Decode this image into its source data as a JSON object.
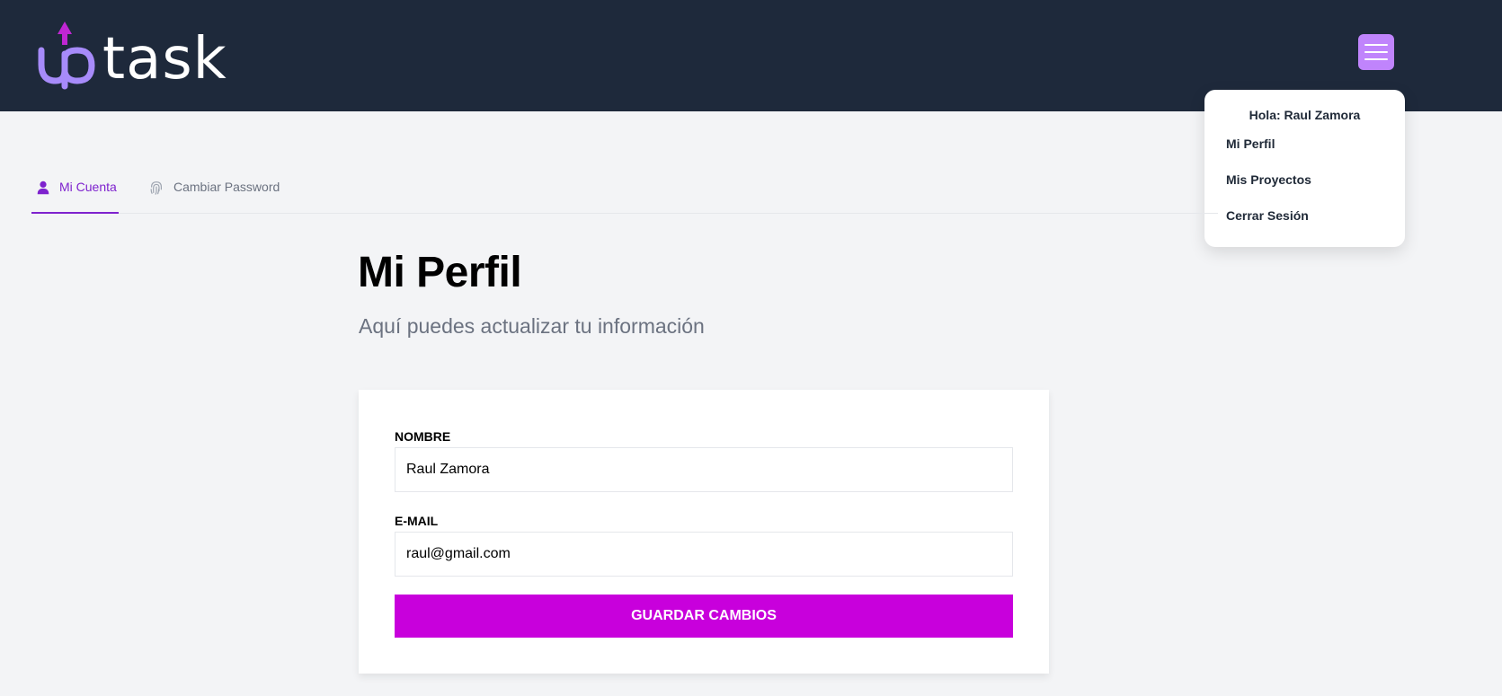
{
  "header": {
    "logo": {
      "prefix": "up",
      "suffix": "task",
      "icon": "arrow-up-logo-mark"
    },
    "menu_icon": "hamburger-menu-icon"
  },
  "dropdown": {
    "greeting": "Hola: Raul Zamora",
    "items": [
      "Mi Perfil",
      "Mis Proyectos",
      "Cerrar Sesión"
    ]
  },
  "tabs": [
    {
      "label": "Mi Cuenta",
      "icon": "user-icon",
      "active": true
    },
    {
      "label": "Cambiar Password",
      "icon": "fingerprint-icon",
      "active": false
    }
  ],
  "main": {
    "title": "Mi Perfil",
    "subtitle": "Aquí puedes actualizar tu información"
  },
  "form": {
    "name_label": "Nombre",
    "name_value": "Raul Zamora",
    "email_label": "E-mail",
    "email_value": "raul@gmail.com",
    "submit_label": "Guardar Cambios"
  },
  "colors": {
    "header_bg": "#1e293b",
    "accent_purple": "#7e22ce",
    "menu_button": "#c084fc",
    "submit_button": "#c800dc",
    "page_bg": "#f3f4f6"
  }
}
